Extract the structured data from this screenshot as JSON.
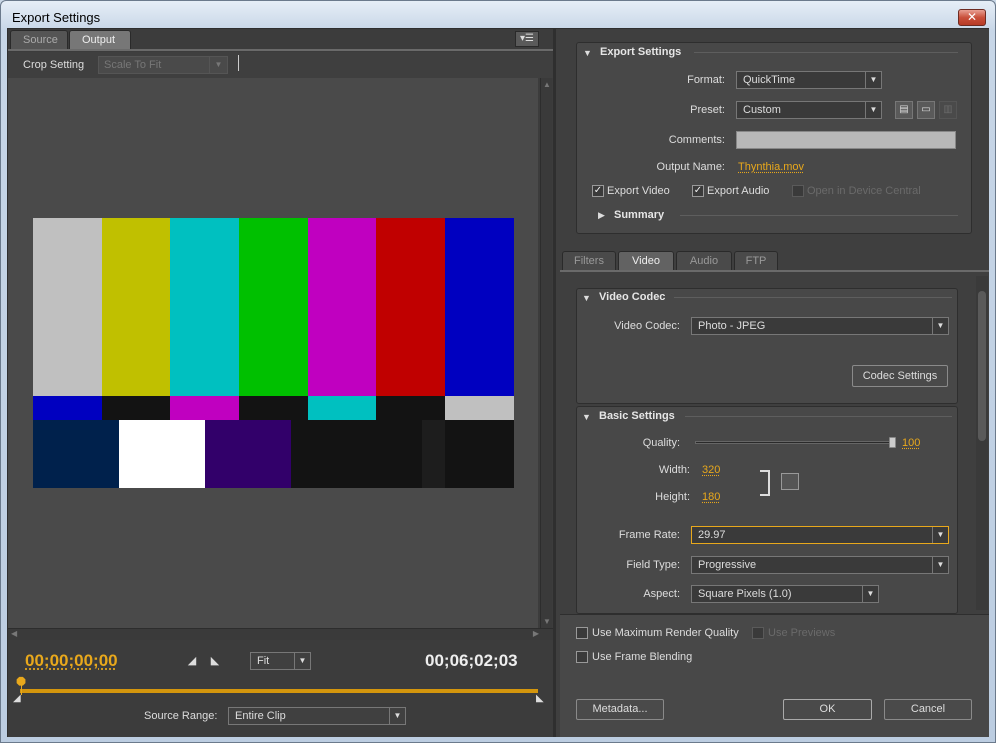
{
  "window": {
    "title": "Export Settings"
  },
  "left": {
    "tabs": [
      "Source",
      "Output"
    ],
    "active_tab": "Output",
    "crop_label": "Crop Setting",
    "crop_value": "Scale To Fit",
    "timecode_start": "00;00;00;00",
    "timecode_end": "00;06;02;03",
    "zoom_value": "Fit",
    "source_range_label": "Source Range:",
    "source_range_value": "Entire Clip"
  },
  "export": {
    "section_title": "Export Settings",
    "format_label": "Format:",
    "format_value": "QuickTime",
    "preset_label": "Preset:",
    "preset_value": "Custom",
    "comments_label": "Comments:",
    "comments_value": "",
    "output_name_label": "Output Name:",
    "output_name_value": "Thynthia.mov",
    "export_video_label": "Export Video",
    "export_audio_label": "Export Audio",
    "device_central_label": "Open in Device Central",
    "summary_label": "Summary"
  },
  "settings_tabs": [
    "Filters",
    "Video",
    "Audio",
    "FTP"
  ],
  "active_settings_tab": "Video",
  "video": {
    "codec_section_title": "Video Codec",
    "codec_label": "Video Codec:",
    "codec_value": "Photo - JPEG",
    "codec_settings_button": "Codec Settings",
    "basic_section_title": "Basic Settings",
    "quality_label": "Quality:",
    "quality_value": "100",
    "width_label": "Width:",
    "width_value": "320",
    "height_label": "Height:",
    "height_value": "180",
    "frame_rate_label": "Frame Rate:",
    "frame_rate_value": "29.97",
    "field_type_label": "Field Type:",
    "field_type_value": "Progressive",
    "aspect_label": "Aspect:",
    "aspect_value": "Square Pixels (1.0)"
  },
  "bottom": {
    "max_render_label": "Use Maximum Render Quality",
    "use_previews_label": "Use Previews",
    "frame_blending_label": "Use Frame Blending",
    "metadata_button": "Metadata...",
    "ok_button": "OK",
    "cancel_button": "Cancel"
  },
  "colors": {
    "accent": "#e8a81c",
    "panel_bg": "#3c3c3c",
    "colorbars_top": [
      "#c0c0c0",
      "#c0c000",
      "#00c0c0",
      "#00c000",
      "#c000c0",
      "#c00000",
      "#0000c0"
    ],
    "colorbars_mid": [
      "#0000c0",
      "#131313",
      "#c000c0",
      "#131313",
      "#00c0c0",
      "#131313",
      "#c0c0c0"
    ],
    "colorbars_bottom": [
      "#00214c",
      "#ffffff",
      "#32006a",
      "#131313",
      "#090909",
      "#131313",
      "#1d1d1d",
      "#131313"
    ]
  }
}
